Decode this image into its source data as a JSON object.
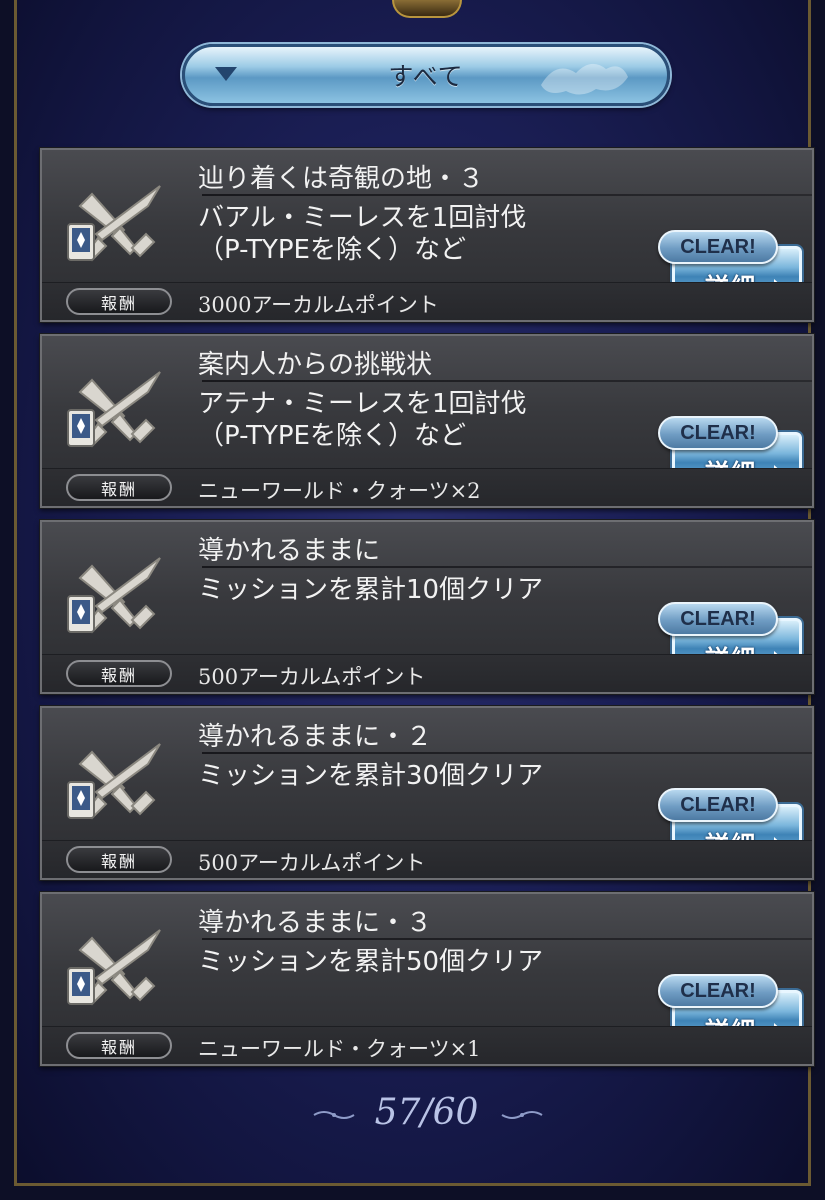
{
  "filter": {
    "label": "すべて"
  },
  "reward_badge_label": "報酬",
  "clear_label": "CLEAR!",
  "detail_label": "詳細",
  "missions": [
    {
      "title": "辿り着くは奇観の地・３",
      "desc_line1": "バアル・ミーレスを1回討伐",
      "desc_line2": "（P-TYPEを除く）など",
      "reward": "3000アーカルムポイント"
    },
    {
      "title": "案内人からの挑戦状",
      "desc_line1": "アテナ・ミーレスを1回討伐",
      "desc_line2": "（P-TYPEを除く）など",
      "reward": "ニューワールド・クォーツ×2"
    },
    {
      "title": "導かれるままに",
      "desc_line1": "ミッションを累計10個クリア",
      "desc_line2": "",
      "reward": "500アーカルムポイント"
    },
    {
      "title": "導かれるままに・２",
      "desc_line1": "ミッションを累計30個クリア",
      "desc_line2": "",
      "reward": "500アーカルムポイント"
    },
    {
      "title": "導かれるままに・３",
      "desc_line1": "ミッションを累計50個クリア",
      "desc_line2": "",
      "reward": "ニューワールド・クォーツ×1"
    }
  ],
  "pager": {
    "text": "57/60"
  },
  "colors": {
    "filter_blue": "#6fa7cf",
    "panel_gray": "#3a3b3f",
    "background_navy": "#1c2058"
  }
}
